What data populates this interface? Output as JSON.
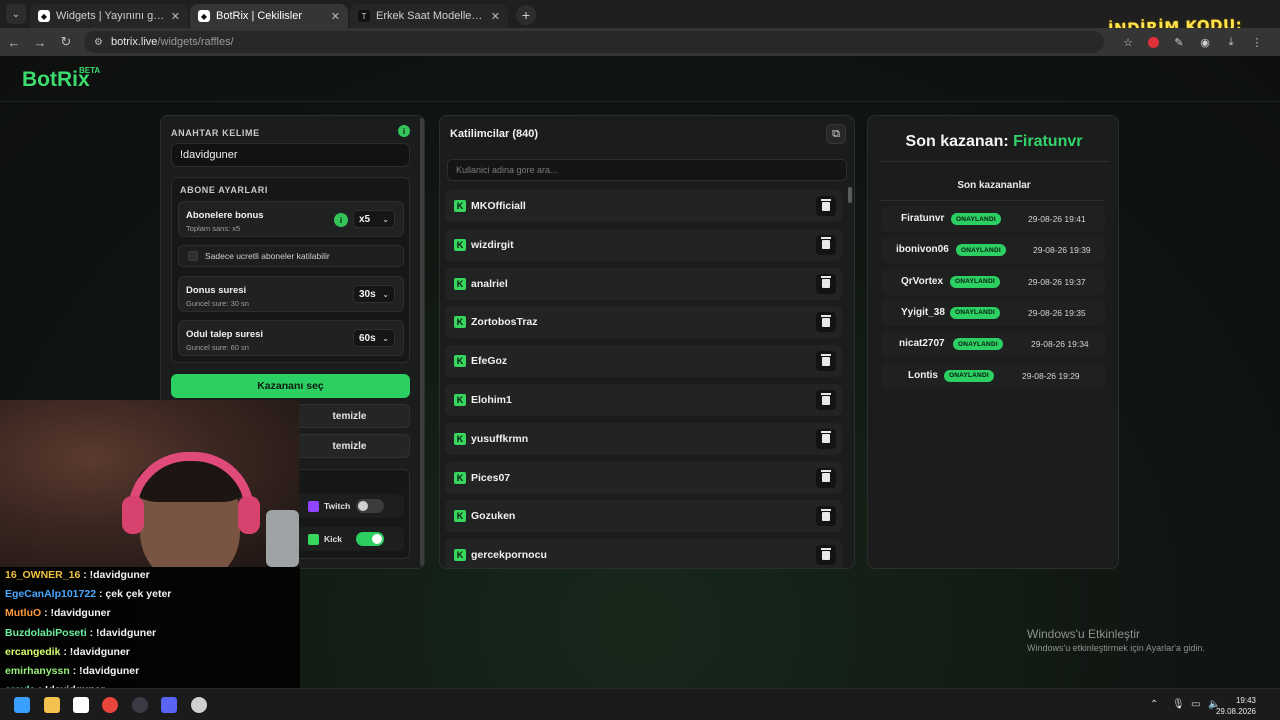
{
  "browser": {
    "tabs": [
      {
        "title": "Widgets | Yayınını güçlendirmek",
        "active": false
      },
      {
        "title": "BotRix | Cekilisler",
        "active": true
      },
      {
        "title": "Erkek Saat Modelleri ve Fiyatları",
        "active": false
      }
    ],
    "url_host": "botrix.live",
    "url_path": "/widgets/raffles/",
    "promo_text": "İNDİRİM KODU:"
  },
  "site": {
    "logo": "BotRix",
    "logo_badge": "BETA"
  },
  "settings": {
    "keyword_label": "ANAHTAR KELIME",
    "keyword_value": "!davidguner",
    "subscriber_section_title": "ABONE AYARLARI",
    "sub_bonus_title": "Abonelere bonus",
    "sub_bonus_sub": "Toplam sans: x5",
    "sub_bonus_value": "x5",
    "paid_only_label": "Sadece ucretli aboneler katilabilir",
    "duration_title": "Donus suresi",
    "duration_sub": "Guncel sure: 30 sn",
    "duration_value": "30s",
    "claim_title": "Odul talep suresi",
    "claim_sub": "Guncel sure: 60 sn",
    "claim_value": "60s",
    "pick_winner_label": "Kazananı seç",
    "clear_btn_1": "temizle",
    "clear_btn_2": "temizle",
    "platforms": [
      {
        "name": "Twitch",
        "enabled": false,
        "color": "#9146ff"
      },
      {
        "name": "Kick",
        "enabled": true,
        "color": "#36d65f"
      }
    ]
  },
  "participants": {
    "title": "Katilimcilar (840)",
    "search_placeholder": "Kullanici adina gore ara...",
    "list": [
      "MKOfficiall",
      "wizdirgit",
      "analriel",
      "ZortobosTraz",
      "EfeGoz",
      "Elohim1",
      "yusuffkrmn",
      "Pices07",
      "Gozuken",
      "gercekpornocu"
    ]
  },
  "winners": {
    "last_winner_prefix": "Son kazanan:",
    "last_winner_name": "Firatunvr",
    "recent_title": "Son kazananlar",
    "badge_label": "ONAYLANDI",
    "list": [
      {
        "name": "Firatunvr",
        "time": "29-08-26 19:41"
      },
      {
        "name": "ibonivon06",
        "time": "29-08-26 19:39"
      },
      {
        "name": "QrVortex",
        "time": "29-08-26 19:37"
      },
      {
        "name": "Yyigit_38",
        "time": "29-08-26 19:35"
      },
      {
        "name": "nicat2707",
        "time": "29-08-26 19:34"
      },
      {
        "name": "Lontis",
        "time": "29-08-26 19:29"
      }
    ]
  },
  "watermark": {
    "title": "Windows'u Etkinleştir",
    "subtitle": "Windows'u etkinleştirmek için Ayarlar'a gidin."
  },
  "chat": [
    {
      "user": "16_OWNER_16",
      "color": "#f0c040",
      "message": "!davidguner"
    },
    {
      "user": "EgeCanAlp101722",
      "color": "#4aa8ff",
      "message": "çek çek yeter"
    },
    {
      "user": "MutluO",
      "color": "#ff9a3c",
      "message": "!davidguner"
    },
    {
      "user": "BuzdolabiPoseti",
      "color": "#6cf0a0",
      "message": "!davidguner"
    },
    {
      "user": "ercangedik",
      "color": "#d7ff6a",
      "message": "!davidguner"
    },
    {
      "user": "emirhanyssn",
      "color": "#9af07a",
      "message": "!davidguner"
    },
    {
      "user": "erayla",
      "color": "#6cf0c8",
      "message": "!davidguner"
    }
  ],
  "taskbar": {
    "time": "19:43",
    "date": "29.08.2026"
  }
}
